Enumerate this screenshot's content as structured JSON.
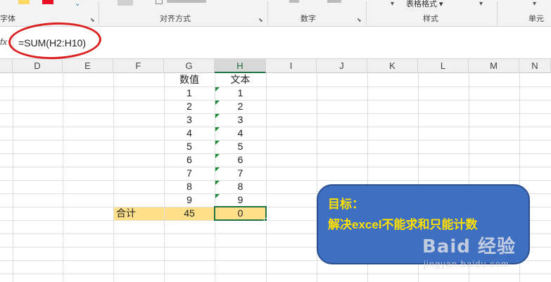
{
  "ribbon": {
    "groups": [
      {
        "label": "字体"
      },
      {
        "label": "对齐方式"
      },
      {
        "label": "数字"
      },
      {
        "label": "样式"
      },
      {
        "label": "单元"
      }
    ],
    "table_format_label": "表格格式 ▾",
    "font_color": "#e81123",
    "highlight_color": "#ffd966",
    "launcher_icon": "dialog-launcher-icon"
  },
  "formula_bar": {
    "fx_label": "fx",
    "formula": "=SUM(H2:H10)"
  },
  "columns": [
    "D",
    "E",
    "F",
    "G",
    "H",
    "I",
    "J",
    "K",
    "L",
    "M",
    "N"
  ],
  "active_column": "H",
  "table": {
    "header_numeric": "数值",
    "header_text": "文本",
    "numeric_values": [
      "1",
      "2",
      "3",
      "4",
      "5",
      "6",
      "7",
      "8",
      "9"
    ],
    "text_values": [
      "1",
      "2",
      "3",
      "4",
      "5",
      "6",
      "7",
      "8",
      "9"
    ],
    "total_label": "合计",
    "total_numeric": "45",
    "total_text": "0"
  },
  "callout": {
    "line1": "目标：",
    "line2": "解决excel不能求和只能计数",
    "color": "#3f6fc1",
    "text_color": "#ffe000"
  },
  "watermark": {
    "logo": "Baid 经验",
    "url": "jingyan.baidu.com"
  },
  "annotation_color": "#dc2020",
  "selection_color": "#217346"
}
